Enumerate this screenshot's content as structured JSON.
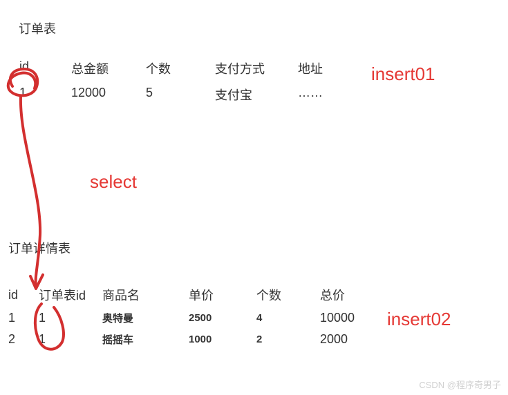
{
  "table1": {
    "title": "订单表",
    "headers": {
      "c1": "id",
      "c2": "总金额",
      "c3": "个数",
      "c4": "支付方式",
      "c5": "地址"
    },
    "row": {
      "c1": "1",
      "c2": "12000",
      "c3": "5",
      "c4": "支付宝",
      "c5": "……"
    }
  },
  "table2": {
    "title": "订单详情表",
    "headers": {
      "c1": "id",
      "c2": "订单表id",
      "c3": "商品名",
      "c4": "单价",
      "c5": "个数",
      "c6": "总价"
    },
    "rows": [
      {
        "c1": "1",
        "c2": "1",
        "c3": "奥特曼",
        "c4": "2500",
        "c5": "4",
        "c6": "10000"
      },
      {
        "c1": "2",
        "c2": "1",
        "c3": "摇摇车",
        "c4": "1000",
        "c5": "2",
        "c6": "2000"
      }
    ]
  },
  "labels": {
    "insert01": "insert01",
    "select": "select",
    "insert02": "insert02"
  },
  "watermark": "CSDN @程序奇男子",
  "annotations": {
    "color": "#d32f2f"
  }
}
